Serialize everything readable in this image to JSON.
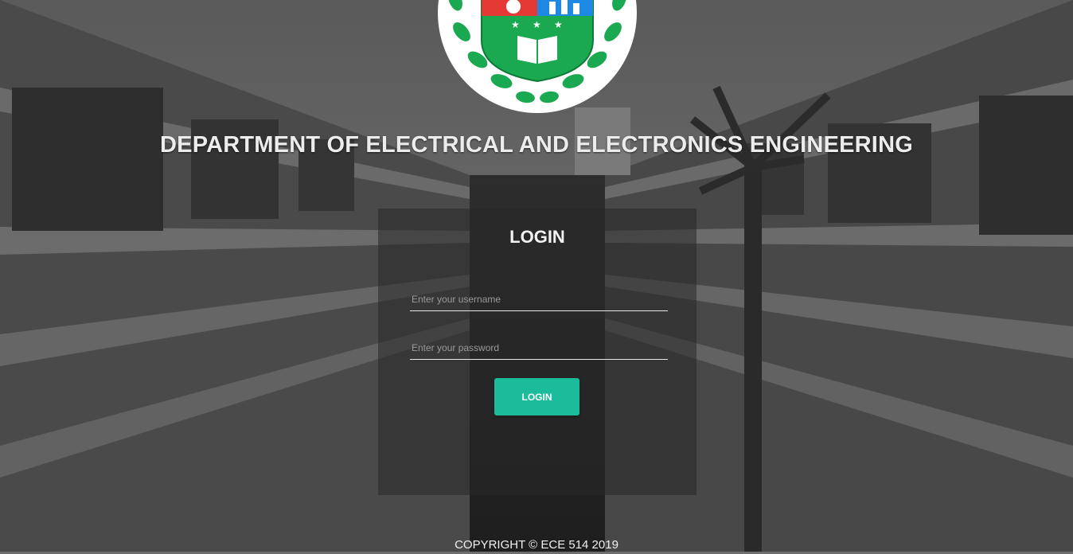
{
  "department_title": "DEPARTMENT OF ELECTRICAL AND ELECTRONICS ENGINEERING",
  "login": {
    "heading": "LOGIN",
    "username_placeholder": "Enter your username",
    "password_placeholder": "Enter your password",
    "button_label": "LOGIN"
  },
  "footer": {
    "copyright": "COPYRIGHT © ECE 514 2019"
  },
  "colors": {
    "accent": "#1abc9c",
    "logo_green": "#1aa850",
    "logo_red": "#e53935",
    "logo_blue": "#1e88e5"
  },
  "icons": {
    "logo": "university-crest-logo"
  }
}
